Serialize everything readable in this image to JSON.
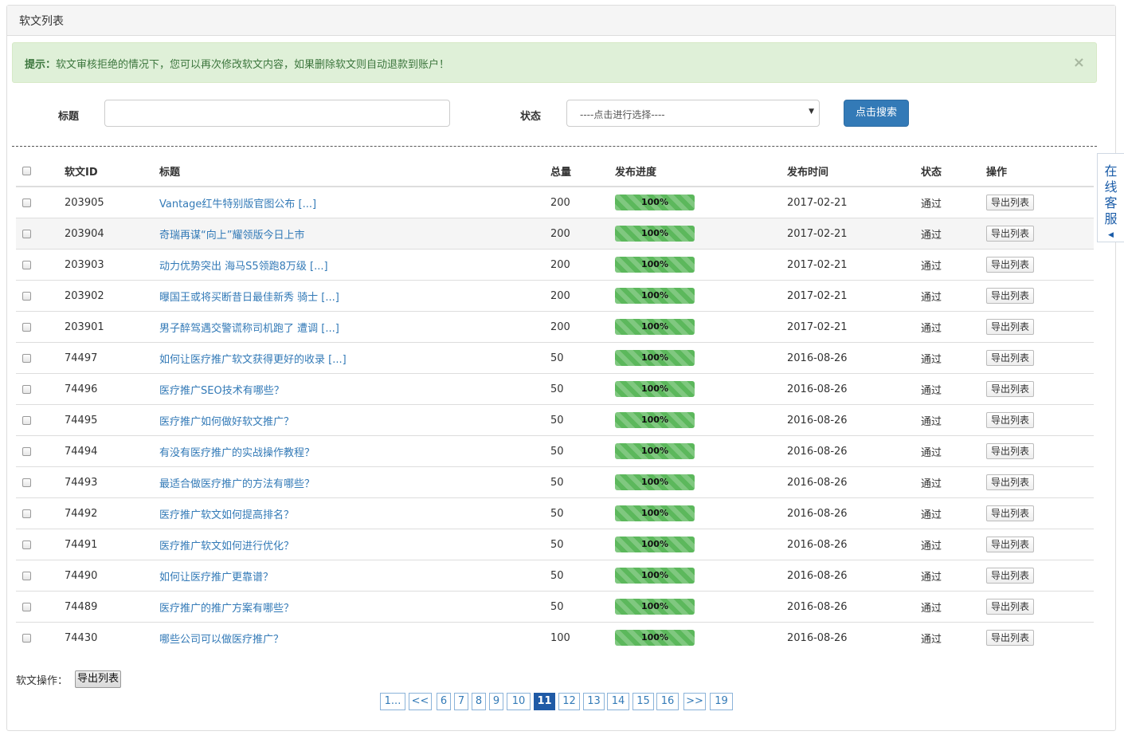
{
  "panel": {
    "title": "软文列表"
  },
  "alert": {
    "prefix": "提示：",
    "message": "软文审核拒绝的情况下，您可以再次修改软文内容，如果删除软文则自动退款到账户！",
    "close": "×"
  },
  "search": {
    "title_label": "标题",
    "title_value": "",
    "status_label": "状态",
    "status_selected": "----点击进行选择----",
    "button": "点击搜索"
  },
  "table": {
    "headers": {
      "id": "软文ID",
      "title": "标题",
      "total": "总量",
      "progress": "发布进度",
      "time": "发布时间",
      "status": "状态",
      "action": "操作"
    },
    "rows": [
      {
        "id": "203905",
        "title": "Vantage红牛特别版官图公布 [...]",
        "total": "200",
        "progress": "100%",
        "time": "2017-02-21",
        "status": "通过",
        "action": "导出列表"
      },
      {
        "id": "203904",
        "title": "奇瑞再谋“向上”耀领版今日上市",
        "total": "200",
        "progress": "100%",
        "time": "2017-02-21",
        "status": "通过",
        "action": "导出列表"
      },
      {
        "id": "203903",
        "title": "动力优势突出 海马S5领跑8万级 [...]",
        "total": "200",
        "progress": "100%",
        "time": "2017-02-21",
        "status": "通过",
        "action": "导出列表"
      },
      {
        "id": "203902",
        "title": "曝国王或将买断昔日最佳新秀 骑士 [...]",
        "total": "200",
        "progress": "100%",
        "time": "2017-02-21",
        "status": "通过",
        "action": "导出列表"
      },
      {
        "id": "203901",
        "title": "男子醉驾遇交警谎称司机跑了 遭调 [...]",
        "total": "200",
        "progress": "100%",
        "time": "2017-02-21",
        "status": "通过",
        "action": "导出列表"
      },
      {
        "id": "74497",
        "title": "如何让医疗推广软文获得更好的收录 [...]",
        "total": "50",
        "progress": "100%",
        "time": "2016-08-26",
        "status": "通过",
        "action": "导出列表"
      },
      {
        "id": "74496",
        "title": "医疗推广SEO技术有哪些？",
        "total": "50",
        "progress": "100%",
        "time": "2016-08-26",
        "status": "通过",
        "action": "导出列表"
      },
      {
        "id": "74495",
        "title": "医疗推广如何做好软文推广？",
        "total": "50",
        "progress": "100%",
        "time": "2016-08-26",
        "status": "通过",
        "action": "导出列表"
      },
      {
        "id": "74494",
        "title": "有没有医疗推广的实战操作教程？",
        "total": "50",
        "progress": "100%",
        "time": "2016-08-26",
        "status": "通过",
        "action": "导出列表"
      },
      {
        "id": "74493",
        "title": "最适合做医疗推广的方法有哪些？",
        "total": "50",
        "progress": "100%",
        "time": "2016-08-26",
        "status": "通过",
        "action": "导出列表"
      },
      {
        "id": "74492",
        "title": "医疗推广软文如何提高排名？",
        "total": "50",
        "progress": "100%",
        "time": "2016-08-26",
        "status": "通过",
        "action": "导出列表"
      },
      {
        "id": "74491",
        "title": "医疗推广软文如何进行优化？",
        "total": "50",
        "progress": "100%",
        "time": "2016-08-26",
        "status": "通过",
        "action": "导出列表"
      },
      {
        "id": "74490",
        "title": "如何让医疗推广更靠谱？",
        "total": "50",
        "progress": "100%",
        "time": "2016-08-26",
        "status": "通过",
        "action": "导出列表"
      },
      {
        "id": "74489",
        "title": "医疗推广的推广方案有哪些？",
        "total": "50",
        "progress": "100%",
        "time": "2016-08-26",
        "status": "通过",
        "action": "导出列表"
      },
      {
        "id": "74430",
        "title": "哪些公司可以做医疗推广？",
        "total": "100",
        "progress": "100%",
        "time": "2016-08-26",
        "status": "通过",
        "action": "导出列表"
      }
    ]
  },
  "footer": {
    "label": "软文操作：",
    "export_button": "导出列表"
  },
  "pagination": {
    "current": "11",
    "pages": [
      "1...",
      "<<",
      "6",
      "7",
      "8",
      "9",
      "10",
      "11",
      "12",
      "13",
      "14",
      "15",
      "16",
      ">>",
      "19"
    ]
  },
  "side_service": {
    "chars": [
      "在",
      "线",
      "客",
      "服"
    ],
    "arrow": "◀"
  },
  "colors": {
    "accent": "#337ab7",
    "alert_bg": "#dff0d8",
    "alert_text": "#3c763d",
    "progress": "#5cb85c",
    "status_pass": "#2a8a2a",
    "active_page": "#1f5aa6"
  }
}
